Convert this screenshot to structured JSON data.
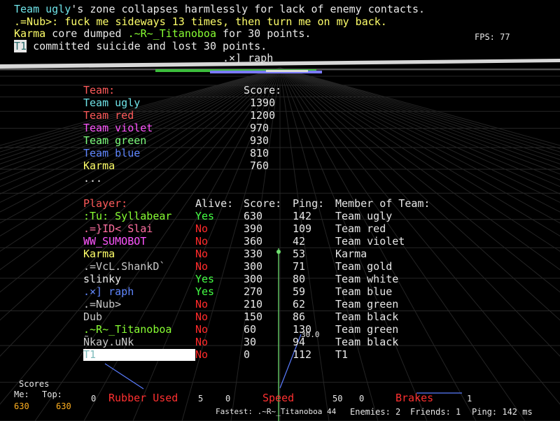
{
  "colors": {
    "white": "#e8e8e8",
    "cyan": "#6fe3e8",
    "red": "#ff5a5a",
    "violet": "#ff55ff",
    "green": "#7dff7d",
    "blue": "#5f86ff",
    "yellow": "#ffff6a",
    "pink": "#ff6fa0",
    "lime": "#88ff33",
    "grey": "#c8c8c8",
    "orange": "#ffb020"
  },
  "console": [
    {
      "parts": [
        {
          "text": "Team ugly",
          "color": "cyan"
        },
        {
          "text": "'s zone collapses harmlessly for lack of enemy contacts.",
          "color": "white"
        }
      ]
    },
    {
      "parts": [
        {
          "text": ".=Nub>: fuck me sideways 13 times, then turn me on my back.",
          "color": "yellow"
        }
      ]
    },
    {
      "parts": [
        {
          "text": "Karma",
          "color": "yellow"
        },
        {
          "text": " core dumped ",
          "color": "white"
        },
        {
          "text": ".~R~_Titanoboa",
          "color": "lime"
        },
        {
          "text": " for 30 points.",
          "color": "white"
        }
      ]
    },
    {
      "parts": [
        {
          "text": "T1",
          "color": "white",
          "highlight": true
        },
        {
          "text": " committed suicide and lost 30 points.",
          "color": "white"
        }
      ]
    }
  ],
  "fps": "FPS: 77",
  "player_label": ".×] raph",
  "team_table": {
    "header_team": "Team:",
    "header_score": "Score:",
    "rows": [
      {
        "name": "Team ugly",
        "score": "1390",
        "color": "cyan"
      },
      {
        "name": "Team red",
        "score": "1200",
        "color": "red"
      },
      {
        "name": "Team violet",
        "score": "970",
        "color": "violet"
      },
      {
        "name": "Team green",
        "score": "930",
        "color": "green"
      },
      {
        "name": "Team blue",
        "score": "810",
        "color": "blue"
      },
      {
        "name": "Karma",
        "score": "760",
        "color": "yellow"
      }
    ],
    "more": "..."
  },
  "player_table": {
    "headers": {
      "player": "Player:",
      "alive": "Alive:",
      "score": "Score:",
      "ping": "Ping:",
      "team": "Member of Team:"
    },
    "rows": [
      {
        "name": ":Tu: Syllabear",
        "color": "lime",
        "alive": "Yes",
        "score": "630",
        "ping": "142",
        "team": "Team ugly"
      },
      {
        "name": ".=}ID< Slai",
        "color": "pink",
        "alive": "No",
        "score": "390",
        "ping": "109",
        "team": "Team red"
      },
      {
        "name": "WW_SUMOBOT",
        "color": "violet",
        "alive": "No",
        "score": "360",
        "ping": "42",
        "team": "Team violet"
      },
      {
        "name": "Karma",
        "color": "yellow",
        "alive": "No",
        "score": "330",
        "ping": "53",
        "team": "Karma"
      },
      {
        "name": ".=VcL.ShankD`",
        "color": "grey",
        "alive": "No",
        "score": "300",
        "ping": "71",
        "team": "Team gold"
      },
      {
        "name": "slinky",
        "color": "white",
        "alive": "Yes",
        "score": "300",
        "ping": "80",
        "team": "Team white"
      },
      {
        "name": ".×] raph",
        "color": "blue",
        "alive": "Yes",
        "score": "270",
        "ping": "59",
        "team": "Team blue"
      },
      {
        "name": ".=Nub>",
        "color": "grey",
        "alive": "No",
        "score": "210",
        "ping": "62",
        "team": "Team green"
      },
      {
        "name": "Dub",
        "color": "grey",
        "alive": "No",
        "score": "150",
        "ping": "86",
        "team": "Team black"
      },
      {
        "name": ".~R~_Titanoboa",
        "color": "lime",
        "alive": "No",
        "score": "60",
        "ping": "130",
        "team": "Team green"
      },
      {
        "name": "Ñkay.uNk",
        "color": "grey",
        "alive": "No",
        "score": "30",
        "ping": "94",
        "team": "Team black"
      },
      {
        "name": "T1",
        "color": "white",
        "alive": "No",
        "score": "0",
        "ping": "112",
        "team": "T1",
        "selected": true
      }
    ]
  },
  "overlay_number": "30.0",
  "hud": {
    "scores_title": "Scores",
    "me_label": "Me:",
    "top_label": "Top:",
    "me_value": "630",
    "top_value": "630",
    "rubber_left": "0",
    "rubber_label": "Rubber Used",
    "rubber_right": "5",
    "speed_left": "0",
    "speed_label": "Speed",
    "speed_right": "50",
    "brakes_left": "0",
    "brakes_label": "Brakes",
    "brakes_right": "1",
    "fastest": "Fastest: .~R~_Titanoboa 44",
    "enemies": "Enemies: 2",
    "friends": "Friends: 1",
    "ping": "Ping: 142 ms"
  }
}
